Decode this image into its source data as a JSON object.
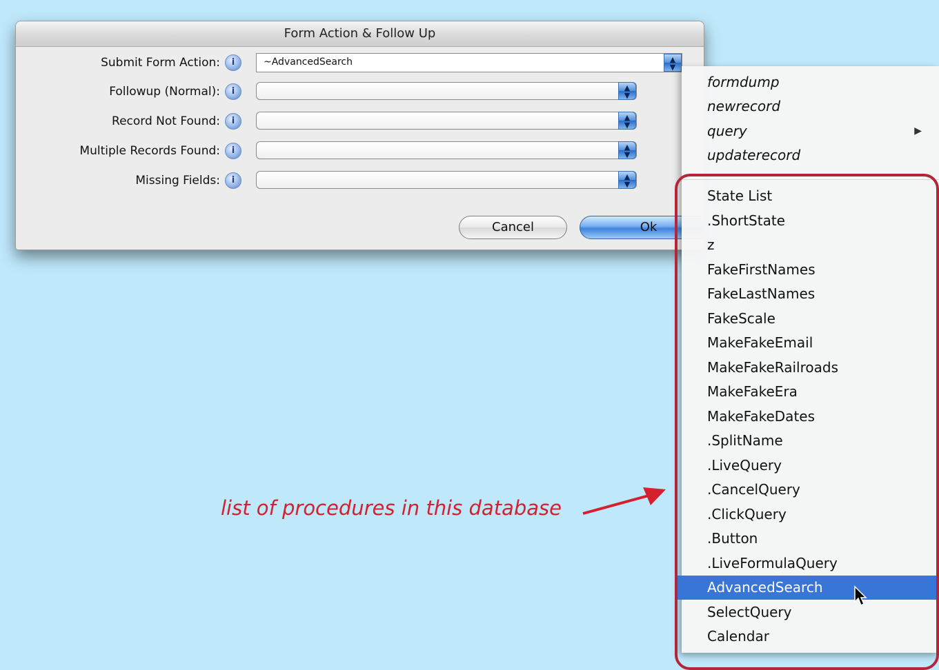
{
  "dialog": {
    "title": "Form Action & Follow Up",
    "rows": [
      {
        "label": "Submit Form Action:",
        "value": "~AdvancedSearch"
      },
      {
        "label": "Followup (Normal):",
        "value": ""
      },
      {
        "label": "Record Not Found:",
        "value": ""
      },
      {
        "label": "Multiple Records Found:",
        "value": ""
      },
      {
        "label": "Missing Fields:",
        "value": ""
      }
    ],
    "cancel_label": "Cancel",
    "ok_label": "Ok"
  },
  "menu": {
    "builtin_items": [
      {
        "label": "formdump"
      },
      {
        "label": "newrecord"
      },
      {
        "label": "query",
        "has_submenu": true
      },
      {
        "label": "updaterecord"
      }
    ],
    "procedure_items": [
      {
        "label": "State List"
      },
      {
        "label": ".ShortState"
      },
      {
        "label": "z"
      },
      {
        "label": "FakeFirstNames"
      },
      {
        "label": "FakeLastNames"
      },
      {
        "label": "FakeScale"
      },
      {
        "label": "MakeFakeEmail"
      },
      {
        "label": "MakeFakeRailroads"
      },
      {
        "label": "MakeFakeEra"
      },
      {
        "label": "MakeFakeDates"
      },
      {
        "label": ".SplitName"
      },
      {
        "label": ".LiveQuery"
      },
      {
        "label": ".CancelQuery"
      },
      {
        "label": ".ClickQuery"
      },
      {
        "label": ".Button"
      },
      {
        "label": ".LiveFormulaQuery"
      },
      {
        "label": "AdvancedSearch",
        "selected": true
      },
      {
        "label": "SelectQuery"
      },
      {
        "label": "Calendar"
      }
    ],
    "submenu_arrow": "▶"
  },
  "annotation": {
    "text": "list of procedures in this database"
  },
  "icons": {
    "info": "info-icon",
    "popup": "updown-arrows-icon",
    "cursor": "arrow-cursor-icon",
    "callout": "red-arrow-icon"
  },
  "colors": {
    "background": "#bfe9fb",
    "selection": "#3875d7",
    "annotation": "#d4202f",
    "highlight_border": "#b3263a"
  }
}
